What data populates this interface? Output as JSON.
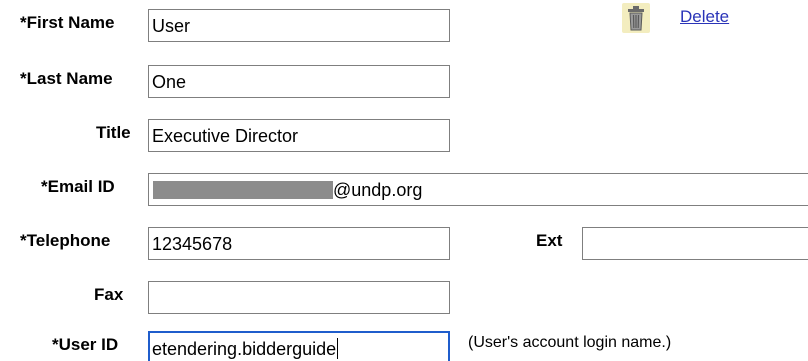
{
  "actions": {
    "delete_label": "Delete"
  },
  "form": {
    "first_name": {
      "label": "*First Name",
      "value": "User"
    },
    "last_name": {
      "label": "*Last Name",
      "value": "One"
    },
    "title": {
      "label": "Title",
      "value": "Executive Director"
    },
    "email": {
      "label": "*Email ID",
      "value_suffix": "@undp.org"
    },
    "telephone": {
      "label": "*Telephone",
      "value": "12345678"
    },
    "ext": {
      "label": "Ext",
      "value": ""
    },
    "fax": {
      "label": "Fax",
      "value": ""
    },
    "user_id": {
      "label": "*User ID",
      "value": "etendering.bidderguide",
      "hint": "(User's account login name.)"
    }
  },
  "colors": {
    "link": "#2a34b8",
    "focus_border": "#1f5dcc",
    "field_border": "#7f7f7f",
    "redaction": "#8c8c8c",
    "icon_background": "#f3edbf"
  },
  "icons": {
    "delete": "trash-icon"
  }
}
